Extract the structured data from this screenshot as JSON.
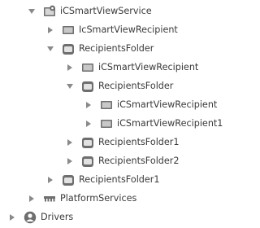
{
  "tree": {
    "nodes": [
      {
        "label": "iCSmartViewService",
        "icon": "service-gear-icon",
        "expanded": true,
        "has_children": true
      },
      {
        "label": "IcSmartViewRecipient",
        "icon": "recipient-icon",
        "expanded": false,
        "has_children": true
      },
      {
        "label": "RecipientsFolder",
        "icon": "folder-icon",
        "expanded": true,
        "has_children": true
      },
      {
        "label": "iCSmartViewRecipient",
        "icon": "recipient-icon",
        "expanded": false,
        "has_children": true
      },
      {
        "label": "RecipientsFolder",
        "icon": "folder-icon",
        "expanded": true,
        "has_children": true
      },
      {
        "label": "iCSmartViewRecipient",
        "icon": "recipient-icon",
        "expanded": false,
        "has_children": true
      },
      {
        "label": "iCSmartViewRecipient1",
        "icon": "recipient-icon",
        "expanded": false,
        "has_children": true
      },
      {
        "label": "RecipientsFolder1",
        "icon": "folder-icon",
        "expanded": false,
        "has_children": true
      },
      {
        "label": "RecipientsFolder2",
        "icon": "folder-icon",
        "expanded": false,
        "has_children": true
      },
      {
        "label": "RecipientsFolder1",
        "icon": "folder-icon",
        "expanded": false,
        "has_children": true
      },
      {
        "label": "PlatformServices",
        "icon": "platform-services-icon",
        "expanded": false,
        "has_children": true
      },
      {
        "label": "Drivers",
        "icon": "drivers-icon",
        "expanded": false,
        "has_children": true
      }
    ]
  },
  "colors": {
    "text": "#3a3a3a",
    "arrow": "#8a8a8a",
    "icon_dark": "#6e6e6e",
    "icon_light": "#d0d0d0"
  }
}
